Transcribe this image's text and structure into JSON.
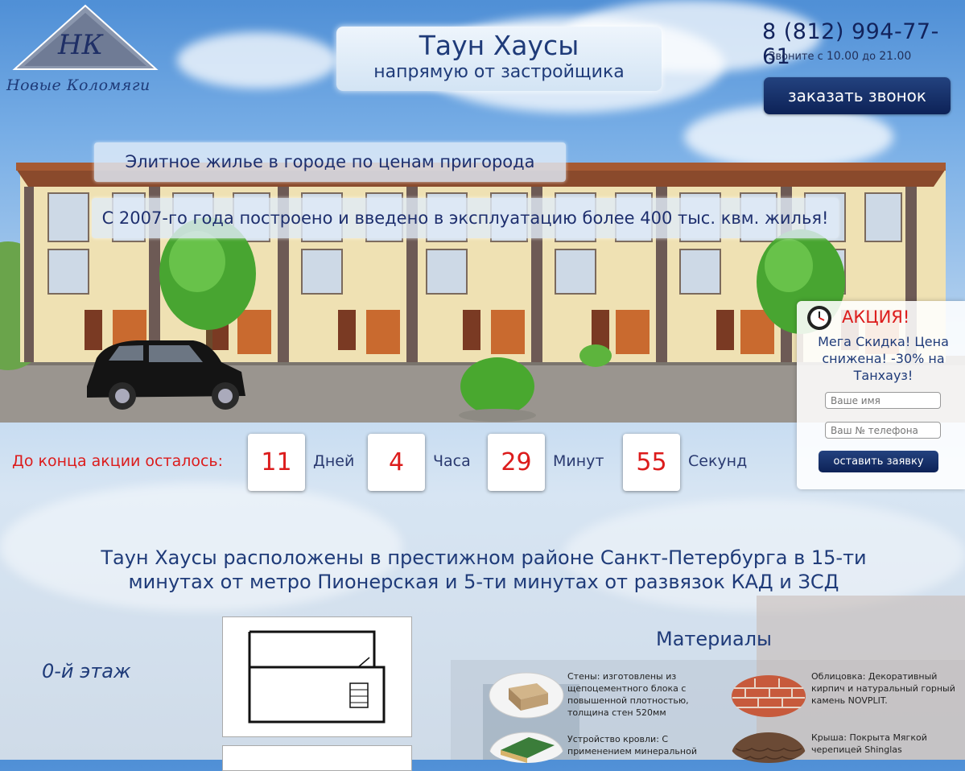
{
  "logo": {
    "initials": "НК",
    "caption": "Новые Коломяги"
  },
  "header": {
    "title": "Таун Хаусы",
    "subtitle": "напрямую от застройщика",
    "phone": "8 (812) 994-77-61",
    "hours_prefix": "Звоните с",
    "hours_from": "10.00",
    "hours_mid": "до",
    "hours_to": "21.00",
    "call_button": "заказать звонок"
  },
  "banners": {
    "line1": "Элитное жилье в городе по ценам пригорода",
    "line2": "С 2007-го года построено и введено в эксплуатацию более 400 тыс. квм. жилья!"
  },
  "countdown": {
    "label": "До конца акции осталось:",
    "days": "11",
    "days_unit": "Дней",
    "hours": "4",
    "hours_unit": "Часа",
    "minutes": "29",
    "minutes_unit": "Минут",
    "seconds": "55",
    "seconds_unit": "Секунд"
  },
  "promo": {
    "title": "АКЦИЯ!",
    "text": "Мега Скидка! Цена снижена! -30% на Танхауз!",
    "name_placeholder": "Ваше имя",
    "phone_placeholder": "Ваш № телефона",
    "submit": "оставить заявку"
  },
  "location": {
    "headline": "Таун Хаусы расположены в престижном районе Санкт-Петербурга в 15-ти минутах от метро  Пионерская  и 5-ти минутах от развязок КАД и ЗСД"
  },
  "plan": {
    "floor_label": "0-й этаж"
  },
  "materials": {
    "title": "Материалы",
    "walls": "Стены: изготовлены из щепоцементного блока с повышенной плотностью, толщина стен 520мм",
    "facing": "Облицовка: Декоративный кирпич и натуральный горный камень NOVPLIT.",
    "roof_install": " Устройство кровли: С применением минеральной",
    "roof": "Крыша: Покрыта Мягкой черепицей Shinglas"
  },
  "colors": {
    "accent": "#1f3b79",
    "button": "#0d2257",
    "alert": "#dc1c1c"
  }
}
